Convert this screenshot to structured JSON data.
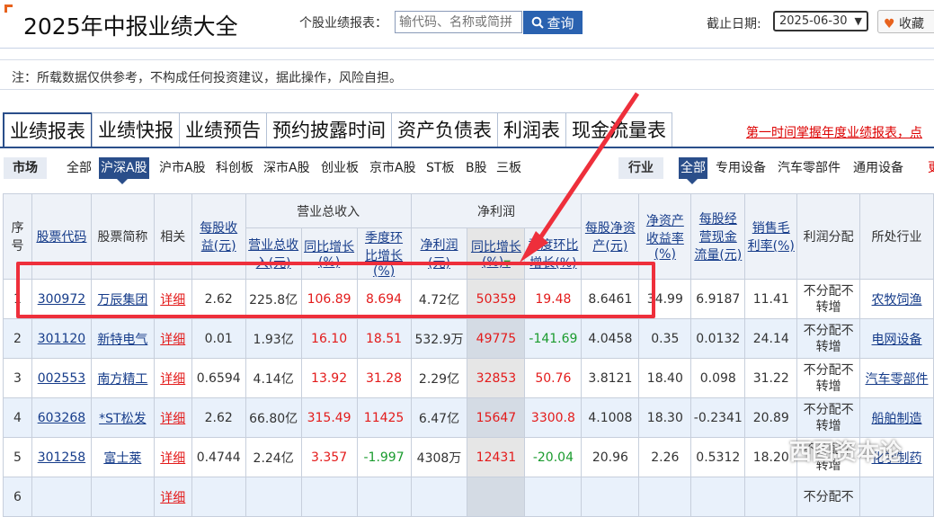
{
  "header": {
    "title": "2025年中报业绩大全",
    "search_label": "个股业绩报表：",
    "search_placeholder": "输代码、名称或简拼",
    "search_button": "查询",
    "date_label": "截止日期:",
    "date_value": "2025-06-30",
    "favorite_button": "收藏"
  },
  "notice": "注：所载数据仅供参考，不构成任何投资建议，据此操作，风险自担。",
  "tabs": [
    "业绩报表",
    "业绩快报",
    "业绩预告",
    "预约披露时间",
    "资产负债表",
    "利润表",
    "现金流量表"
  ],
  "promo_link": "第一时间掌握年度业绩报表，点",
  "market": {
    "label": "市场",
    "options": [
      "全部",
      "沪深A股",
      "沪市A股",
      "科创板",
      "深市A股",
      "创业板",
      "京市A股",
      "ST板",
      "B股",
      "三板"
    ],
    "selected": "沪深A股"
  },
  "industry": {
    "label": "行业",
    "options": [
      "全部",
      "专用设备",
      "汽车零部件",
      "通用设备",
      "更"
    ],
    "selected": "全部"
  },
  "table": {
    "headers": {
      "seq": "序号",
      "code": "股票代码",
      "name": "股票简称",
      "related": "相关",
      "eps": "每股收益(元)",
      "revenue_group": "营业总收入",
      "revenue": "营业总收入(元)",
      "revenue_yoy": "同比增长(%)",
      "revenue_qoq": "季度环比增长(%)",
      "profit_group": "净利润",
      "profit": "净利润(元)",
      "profit_yoy": "同比增长(%)",
      "profit_qoq": "季度环比增长(%)",
      "bvps": "每股净资产(元)",
      "roe": "净资产收益率(%)",
      "cfps": "每股经营现金流量(元)",
      "gross_margin": "销售毛利率(%)",
      "dividend": "利润分配",
      "industry": "所处行业"
    },
    "rows": [
      {
        "seq": "1",
        "code": "300972",
        "name": "万辰集团",
        "related": "详细",
        "eps": "2.62",
        "revenue": "225.8亿",
        "revenue_yoy": "106.89",
        "revenue_qoq": "8.694",
        "profit": "4.72亿",
        "profit_yoy": "50359",
        "profit_qoq": "19.48",
        "bvps": "8.6461",
        "roe": "34.99",
        "cfps": "6.9187",
        "gross_margin": "11.41",
        "dividend": "不分配不转增",
        "industry": "农牧饲渔"
      },
      {
        "seq": "2",
        "code": "301120",
        "name": "新特电气",
        "related": "详细",
        "eps": "0.01",
        "revenue": "1.93亿",
        "revenue_yoy": "16.10",
        "revenue_qoq": "18.51",
        "profit": "532.9万",
        "profit_yoy": "49775",
        "profit_qoq": "-141.69",
        "bvps": "4.0458",
        "roe": "0.35",
        "cfps": "0.0132",
        "gross_margin": "24.14",
        "dividend": "不分配不转增",
        "industry": "电网设备"
      },
      {
        "seq": "3",
        "code": "002553",
        "name": "南方精工",
        "related": "详细",
        "eps": "0.6594",
        "revenue": "4.14亿",
        "revenue_yoy": "13.92",
        "revenue_qoq": "31.28",
        "profit": "2.29亿",
        "profit_yoy": "32853",
        "profit_qoq": "50.76",
        "bvps": "3.8121",
        "roe": "18.40",
        "cfps": "0.098",
        "gross_margin": "31.22",
        "dividend": "不分配不转增",
        "industry": "汽车零部件"
      },
      {
        "seq": "4",
        "code": "603268",
        "name": "*ST松发",
        "related": "详细",
        "eps": "2.62",
        "revenue": "66.80亿",
        "revenue_yoy": "315.49",
        "revenue_qoq": "11425",
        "profit": "6.47亿",
        "profit_yoy": "15647",
        "profit_qoq": "3300.8",
        "bvps": "4.1008",
        "roe": "18.30",
        "cfps": "-0.2341",
        "gross_margin": "20.89",
        "dividend": "不分配不转增",
        "industry": "船舶制造"
      },
      {
        "seq": "5",
        "code": "301258",
        "name": "富士莱",
        "related": "详细",
        "eps": "0.4744",
        "revenue": "2.24亿",
        "revenue_yoy": "3.357",
        "revenue_qoq": "-1.997",
        "profit": "4308万",
        "profit_yoy": "12431",
        "profit_qoq": "-20.04",
        "bvps": "20.96",
        "roe": "2.26",
        "cfps": "0.5312",
        "gross_margin": "18.20",
        "dividend": "不分配不转增",
        "industry": "化学制药"
      },
      {
        "seq": "6",
        "code": "",
        "name": "",
        "related": "详细",
        "eps": "",
        "revenue": "",
        "revenue_yoy": "",
        "revenue_qoq": "",
        "profit": "",
        "profit_yoy": "",
        "profit_qoq": "",
        "bvps": "",
        "roe": "",
        "cfps": "",
        "gross_margin": "",
        "dividend": "不分配不",
        "industry": ""
      }
    ]
  },
  "watermark": "西图资本论",
  "colors": {
    "accent": "#2a4e8a",
    "positive": "#e31b1b",
    "negative": "#1a9b2e",
    "annotation": "#ee2f3b"
  }
}
